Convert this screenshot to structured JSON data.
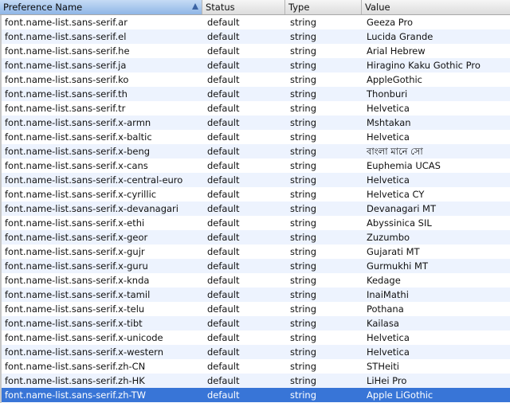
{
  "table": {
    "columns": [
      "Preference Name",
      "Status",
      "Type",
      "Value"
    ],
    "sorted_column": "Preference Name",
    "rows": [
      {
        "name": "font.name-list.sans-serif.ar",
        "status": "default",
        "type": "string",
        "value": "Geeza Pro"
      },
      {
        "name": "font.name-list.sans-serif.el",
        "status": "default",
        "type": "string",
        "value": "Lucida Grande"
      },
      {
        "name": "font.name-list.sans-serif.he",
        "status": "default",
        "type": "string",
        "value": "Arial Hebrew"
      },
      {
        "name": "font.name-list.sans-serif.ja",
        "status": "default",
        "type": "string",
        "value": "Hiragino Kaku Gothic Pro"
      },
      {
        "name": "font.name-list.sans-serif.ko",
        "status": "default",
        "type": "string",
        "value": "AppleGothic"
      },
      {
        "name": "font.name-list.sans-serif.th",
        "status": "default",
        "type": "string",
        "value": "Thonburi"
      },
      {
        "name": "font.name-list.sans-serif.tr",
        "status": "default",
        "type": "string",
        "value": "Helvetica"
      },
      {
        "name": "font.name-list.sans-serif.x-armn",
        "status": "default",
        "type": "string",
        "value": "Mshtakan"
      },
      {
        "name": "font.name-list.sans-serif.x-baltic",
        "status": "default",
        "type": "string",
        "value": "Helvetica"
      },
      {
        "name": "font.name-list.sans-serif.x-beng",
        "status": "default",
        "type": "string",
        "value": "বাংলা মানে সো"
      },
      {
        "name": "font.name-list.sans-serif.x-cans",
        "status": "default",
        "type": "string",
        "value": "Euphemia UCAS"
      },
      {
        "name": "font.name-list.sans-serif.x-central-euro",
        "status": "default",
        "type": "string",
        "value": "Helvetica"
      },
      {
        "name": "font.name-list.sans-serif.x-cyrillic",
        "status": "default",
        "type": "string",
        "value": "Helvetica CY"
      },
      {
        "name": "font.name-list.sans-serif.x-devanagari",
        "status": "default",
        "type": "string",
        "value": "Devanagari MT"
      },
      {
        "name": "font.name-list.sans-serif.x-ethi",
        "status": "default",
        "type": "string",
        "value": "Abyssinica SIL"
      },
      {
        "name": "font.name-list.sans-serif.x-geor",
        "status": "default",
        "type": "string",
        "value": "Zuzumbo"
      },
      {
        "name": "font.name-list.sans-serif.x-gujr",
        "status": "default",
        "type": "string",
        "value": "Gujarati MT"
      },
      {
        "name": "font.name-list.sans-serif.x-guru",
        "status": "default",
        "type": "string",
        "value": "Gurmukhi MT"
      },
      {
        "name": "font.name-list.sans-serif.x-knda",
        "status": "default",
        "type": "string",
        "value": "Kedage"
      },
      {
        "name": "font.name-list.sans-serif.x-tamil",
        "status": "default",
        "type": "string",
        "value": "InaiMathi"
      },
      {
        "name": "font.name-list.sans-serif.x-telu",
        "status": "default",
        "type": "string",
        "value": "Pothana"
      },
      {
        "name": "font.name-list.sans-serif.x-tibt",
        "status": "default",
        "type": "string",
        "value": "Kailasa"
      },
      {
        "name": "font.name-list.sans-serif.x-unicode",
        "status": "default",
        "type": "string",
        "value": "Helvetica"
      },
      {
        "name": "font.name-list.sans-serif.x-western",
        "status": "default",
        "type": "string",
        "value": "Helvetica"
      },
      {
        "name": "font.name-list.sans-serif.zh-CN",
        "status": "default",
        "type": "string",
        "value": "STHeiti"
      },
      {
        "name": "font.name-list.sans-serif.zh-HK",
        "status": "default",
        "type": "string",
        "value": "LiHei Pro"
      },
      {
        "name": "font.name-list.sans-serif.zh-TW",
        "status": "default",
        "type": "string",
        "value": "Apple LiGothic"
      }
    ],
    "selected_row_index": 26
  },
  "colors": {
    "selection": "#3875d7",
    "stripe": "#edf3fe",
    "header_sorted": "#8fb6e6"
  },
  "icons": {
    "sort_indicator": "sort-ascending-icon"
  }
}
